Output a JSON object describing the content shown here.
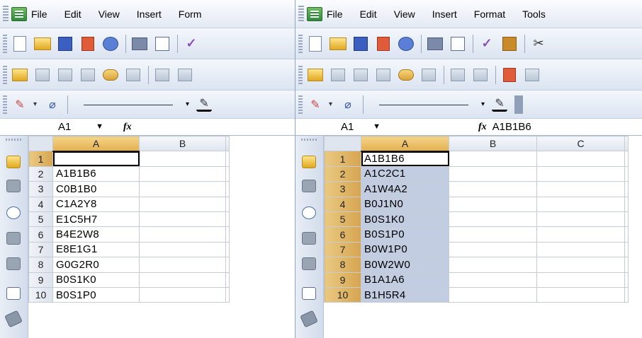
{
  "left": {
    "menu": [
      "File",
      "Edit",
      "View",
      "Insert",
      "Form"
    ],
    "name_box": "A1",
    "formula": "",
    "columns": [
      "A",
      "B"
    ],
    "rows": [
      {
        "num": "1",
        "a": ""
      },
      {
        "num": "2",
        "a": "A1B1B6"
      },
      {
        "num": "3",
        "a": "C0B1B0"
      },
      {
        "num": "4",
        "a": "C1A2Y8"
      },
      {
        "num": "5",
        "a": "E1C5H7"
      },
      {
        "num": "6",
        "a": "B4E2W8"
      },
      {
        "num": "7",
        "a": "E8E1G1"
      },
      {
        "num": "8",
        "a": "G0G2R0"
      },
      {
        "num": "9",
        "a": "B0S1K0"
      },
      {
        "num": "10",
        "a": "B0S1P0"
      }
    ]
  },
  "right": {
    "menu": [
      "File",
      "Edit",
      "View",
      "Insert",
      "Format",
      "Tools"
    ],
    "name_box": "A1",
    "formula": "A1B1B6",
    "columns": [
      "A",
      "B",
      "C"
    ],
    "rows": [
      {
        "num": "1",
        "a": "A1B1B6"
      },
      {
        "num": "2",
        "a": "A1C2C1"
      },
      {
        "num": "3",
        "a": "A1W4A2"
      },
      {
        "num": "4",
        "a": "B0J1N0"
      },
      {
        "num": "5",
        "a": "B0S1K0"
      },
      {
        "num": "6",
        "a": "B0S1P0"
      },
      {
        "num": "7",
        "a": "B0W1P0"
      },
      {
        "num": "8",
        "a": "B0W2W0"
      },
      {
        "num": "9",
        "a": "B1A1A6"
      },
      {
        "num": "10",
        "a": "B1H5R4"
      }
    ]
  },
  "fx_label": "fx"
}
